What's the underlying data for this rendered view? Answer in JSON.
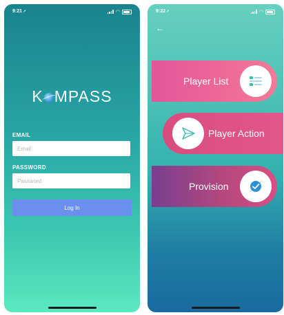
{
  "left_screen": {
    "status_time": "9:21",
    "logo_text_before": "K",
    "logo_text_after": "MPASS",
    "email_label": "EMAIL",
    "email_placeholder": "Email",
    "password_label": "PASSWORD",
    "password_placeholder": "Password",
    "login_label": "Log In"
  },
  "right_screen": {
    "status_time": "9:22",
    "back_icon": "back-arrow-icon",
    "menu": [
      {
        "label": "Player List",
        "icon": "list-icon"
      },
      {
        "label": "Player Action",
        "icon": "send-icon"
      },
      {
        "label": "Provision",
        "icon": "checkmark-icon"
      }
    ]
  },
  "colors": {
    "login_button": "#6b8fef",
    "pill_pink": "#ee6a97",
    "pill_magenta": "#e3568c",
    "pill_purple": "#7a3e8f",
    "icon_teal": "#3fbab0",
    "check_blue": "#2f8fd3"
  }
}
